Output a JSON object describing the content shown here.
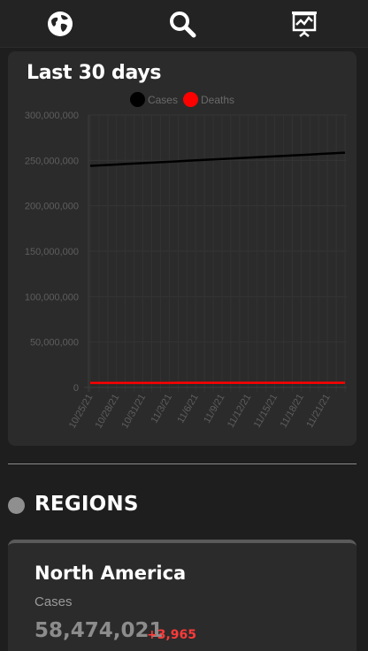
{
  "nav": {
    "tabs": [
      {
        "icon": "globe-icon"
      },
      {
        "icon": "search-icon"
      },
      {
        "icon": "presentation-chart-icon"
      }
    ]
  },
  "chart_card": {
    "title": "Last 30 days"
  },
  "chart_data": {
    "type": "line",
    "title": "Last 30 days",
    "x": [
      "10/25/21",
      "10/26/21",
      "10/27/21",
      "10/28/21",
      "10/29/21",
      "10/30/21",
      "10/31/21",
      "11/1/21",
      "11/2/21",
      "11/3/21",
      "11/4/21",
      "11/5/21",
      "11/6/21",
      "11/7/21",
      "11/8/21",
      "11/9/21",
      "11/10/21",
      "11/11/21",
      "11/12/21",
      "11/13/21",
      "11/14/21",
      "11/15/21",
      "11/16/21",
      "11/17/21",
      "11/18/21",
      "11/19/21",
      "11/20/21",
      "11/21/21",
      "11/22/21",
      "11/23/21"
    ],
    "x_tick_labels": [
      "10/25/21",
      "10/28/21",
      "10/31/21",
      "11/3/21",
      "11/6/21",
      "11/9/21",
      "11/12/21",
      "11/15/21",
      "11/18/21",
      "11/21/21"
    ],
    "y_tick_labels": [
      "300,000,000",
      "250,000,000",
      "200,000,000",
      "150,000,000",
      "100,000,000",
      "50,000,000",
      "0"
    ],
    "ylim": [
      0,
      300000000
    ],
    "grid": true,
    "legend_position": "top-center",
    "series": [
      {
        "name": "Cases",
        "color": "#000000",
        "start": 244000000,
        "end": 258500000
      },
      {
        "name": "Deaths",
        "color": "#ff0000",
        "start": 4950000,
        "end": 5150000
      }
    ]
  },
  "regions": {
    "heading": "REGIONS",
    "cards": [
      {
        "name": "North America",
        "metric_label": "Cases",
        "value": "58,474,021",
        "delta": "+3,965"
      }
    ]
  },
  "colors": {
    "background": "#1e1e1e",
    "card": "#2b2b2b",
    "deaths": "#ff0000",
    "cases": "#000000",
    "delta": "#ff3a3a"
  }
}
